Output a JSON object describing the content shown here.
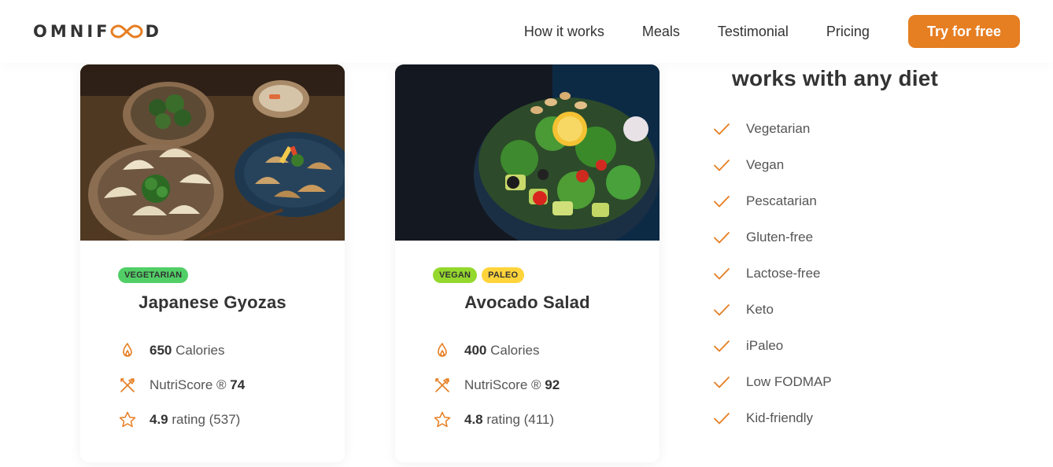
{
  "header": {
    "logo_text_left": "OMNIF",
    "logo_text_right": "D",
    "nav": [
      "How it works",
      "Meals",
      "Testimonial",
      "Pricing"
    ],
    "cta_label": "Try for free",
    "accent_color": "#e67e22"
  },
  "meals": [
    {
      "image": "japanese-gyozas-photo",
      "tags": [
        "VEGETARIAN"
      ],
      "title": "Japanese Gyozas",
      "calories_value": "650",
      "calories_label": "Calories",
      "nutriscore_label": "NutriScore ®",
      "nutriscore_value": "74",
      "rating_value": "4.9",
      "rating_label": "rating (537)"
    },
    {
      "image": "avocado-salad-photo",
      "tags": [
        "VEGAN",
        "PALEO"
      ],
      "title": "Avocado Salad",
      "calories_value": "400",
      "calories_label": "Calories",
      "nutriscore_label": "NutriScore ®",
      "nutriscore_value": "92",
      "rating_value": "4.8",
      "rating_label": "rating (411)"
    }
  ],
  "diets": {
    "title": "works with any diet",
    "items": [
      "Vegetarian",
      "Vegan",
      "Pescatarian",
      "Gluten-free",
      "Lactose-free",
      "Keto",
      "iPaleo",
      "Low FODMAP",
      "Kid-friendly"
    ]
  }
}
